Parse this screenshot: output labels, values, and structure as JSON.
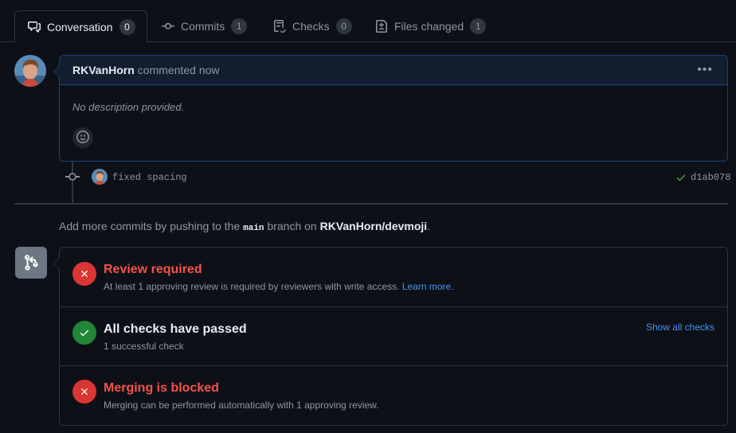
{
  "tabs": [
    {
      "label": "Conversation",
      "count": "0",
      "icon": "comment-discussion-icon"
    },
    {
      "label": "Commits",
      "count": "1",
      "icon": "git-commit-icon"
    },
    {
      "label": "Checks",
      "count": "0",
      "icon": "checklist-icon"
    },
    {
      "label": "Files changed",
      "count": "1",
      "icon": "file-diff-icon"
    }
  ],
  "comment": {
    "author": "RKVanHorn",
    "meta": "commented now",
    "body": "No description provided."
  },
  "commit": {
    "message": "fixed spacing",
    "sha": "d1ab078"
  },
  "push_note": {
    "prefix": "Add more commits by pushing to the",
    "branch": "main",
    "middle": "branch on",
    "repo": "RKVanHorn/devmoji",
    "suffix": "."
  },
  "merge": {
    "review": {
      "title": "Review required",
      "subtitle": "At least 1 approving review is required by reviewers with write access.",
      "link": "Learn more."
    },
    "checks": {
      "title": "All checks have passed",
      "subtitle": "1 successful check",
      "link": "Show all checks"
    },
    "blocked": {
      "title": "Merging is blocked",
      "subtitle": "Merging can be performed automatically with 1 approving review."
    }
  },
  "colors": {
    "background": "#0d1117",
    "accent_blue": "#4493f8",
    "danger": "#f85149",
    "success": "#238636"
  }
}
